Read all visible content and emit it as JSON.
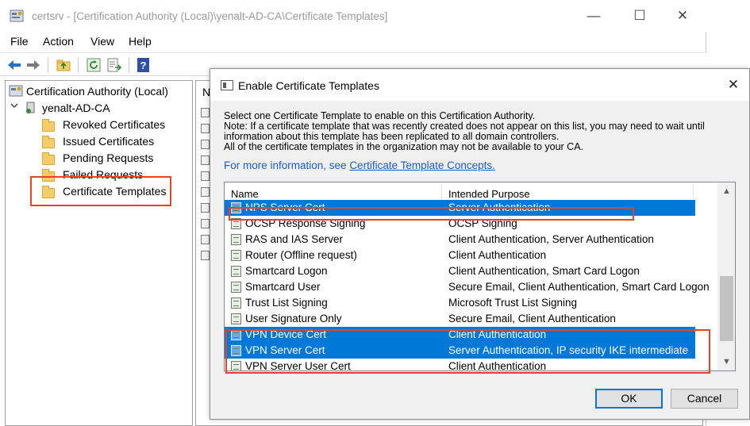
{
  "window": {
    "title": "certsrv - [Certification Authority (Local)\\yenalt-AD-CA\\Certificate Templates]",
    "minimize": "—",
    "maximize": "☐",
    "close": "✕"
  },
  "menu": [
    "File",
    "Action",
    "View",
    "Help"
  ],
  "toolbar": {
    "icons": [
      "back-arrow-icon",
      "forward-arrow-icon",
      "up-folder-icon",
      "refresh-icon",
      "export-list-icon",
      "help-icon"
    ]
  },
  "tree": {
    "root": "Certification Authority (Local)",
    "ca": "yenalt-AD-CA",
    "chevron": "✓",
    "items": [
      "Revoked Certificates",
      "Issued Certificates",
      "Pending Requests",
      "Failed Requests",
      "Certificate Templates"
    ]
  },
  "list_pane": {
    "header_partial": "N"
  },
  "dialog": {
    "title": "Enable Certificate Templates",
    "close": "✕",
    "lines": [
      "Select one Certificate Template to enable on this Certification Authority.",
      "Note: If a certificate template that was recently created does not appear on this list, you may need to wait until",
      "information about this template has been replicated to all domain controllers.",
      "All of the certificate templates in the organization may not be available to your CA."
    ],
    "link_prefix": "For more information, see ",
    "link_text": "Certificate Template Concepts.",
    "columns": [
      "Name",
      "Intended Purpose"
    ],
    "rows": [
      {
        "name": "NPS Server Cert",
        "purpose": "Server Authentication",
        "selected": true
      },
      {
        "name": "OCSP Response Signing",
        "purpose": "OCSP Signing",
        "selected": false
      },
      {
        "name": "RAS and IAS Server",
        "purpose": "Client Authentication, Server Authentication",
        "selected": false
      },
      {
        "name": "Router (Offline request)",
        "purpose": "Client Authentication",
        "selected": false
      },
      {
        "name": "Smartcard Logon",
        "purpose": "Client Authentication, Smart Card Logon",
        "selected": false
      },
      {
        "name": "Smartcard User",
        "purpose": "Secure Email, Client Authentication, Smart Card Logon",
        "selected": false
      },
      {
        "name": "Trust List Signing",
        "purpose": "Microsoft Trust List Signing",
        "selected": false
      },
      {
        "name": "User Signature Only",
        "purpose": "Secure Email, Client Authentication",
        "selected": false
      },
      {
        "name": "VPN Device Cert",
        "purpose": "Client Authentication",
        "selected": true
      },
      {
        "name": "VPN Server Cert",
        "purpose": "Server Authentication, IP security IKE intermediate",
        "selected": true
      },
      {
        "name": "VPN Server User Cert",
        "purpose": "Client Authentication",
        "selected": false
      }
    ],
    "scroll_up": "▲",
    "scroll_down": "▼",
    "ok": "OK",
    "cancel": "Cancel"
  },
  "colors": {
    "selection": "#0078d7",
    "highlight_box": "#e8422c",
    "link": "#1a5cc8"
  }
}
